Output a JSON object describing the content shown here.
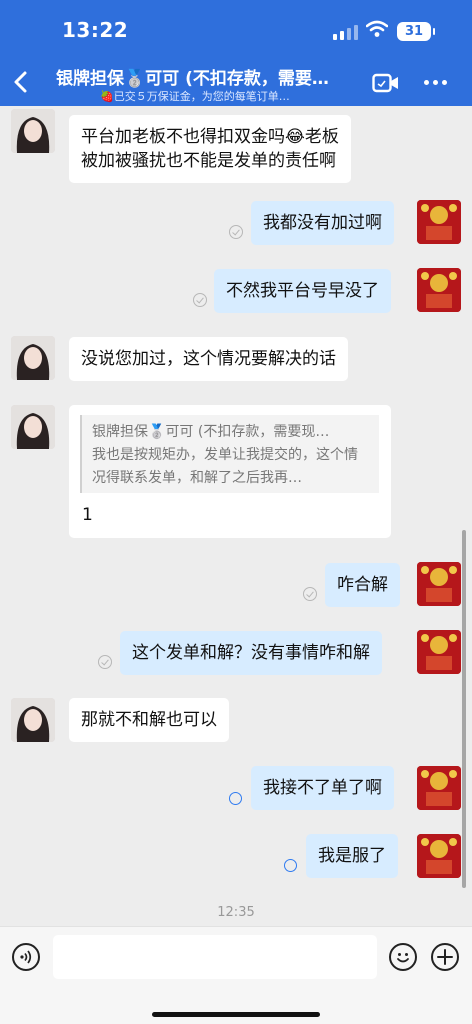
{
  "status_bar": {
    "time": "13:22",
    "battery": "31"
  },
  "header": {
    "title": "银牌担保🥈可可 (不扣存款，需要…",
    "subtitle": "🍓已交５万保证金，为您的每笔订单…",
    "icons": {
      "back": "chevron-left-icon",
      "video": "video-call-icon",
      "more": "more-dots-icon"
    }
  },
  "messages": [
    {
      "side": "in",
      "lines": [
        "平台加老板不也得扣双金吗😂老板",
        "被加被骚扰也不能是发单的责任啊"
      ]
    },
    {
      "side": "out",
      "text": "我都没有加过啊",
      "status": "read"
    },
    {
      "side": "out",
      "text": "不然我平台号早没了",
      "status": "read"
    },
    {
      "side": "in",
      "text": "没说您加过，这个情况要解决的话"
    },
    {
      "side": "in",
      "quote": {
        "author": "银牌担保🥈可可 (不扣存款，需要现…",
        "text": "我也是按规矩办，发单让我提交的，这个情况得联系发单，和解了之后我再…"
      },
      "text": "1"
    },
    {
      "side": "out",
      "text": "咋合解",
      "status": "read"
    },
    {
      "side": "out",
      "text": "这个发单和解？没有事情咋和解",
      "status": "read"
    },
    {
      "side": "in",
      "text": "那就不和解也可以"
    },
    {
      "side": "out",
      "text": "我接不了单了啊",
      "status": "sent"
    },
    {
      "side": "out",
      "text": "我是服了",
      "status": "sent"
    }
  ],
  "timestamp": "12:35",
  "input_bar": {
    "placeholder": "",
    "icons": [
      "voice-icon",
      "emoji-icon",
      "plus-icon"
    ]
  },
  "colors": {
    "header_bg": "#2f6fdc",
    "outgoing_bubble": "#d7ecff",
    "incoming_bubble": "#ffffff",
    "chat_bg": "#ededed"
  }
}
